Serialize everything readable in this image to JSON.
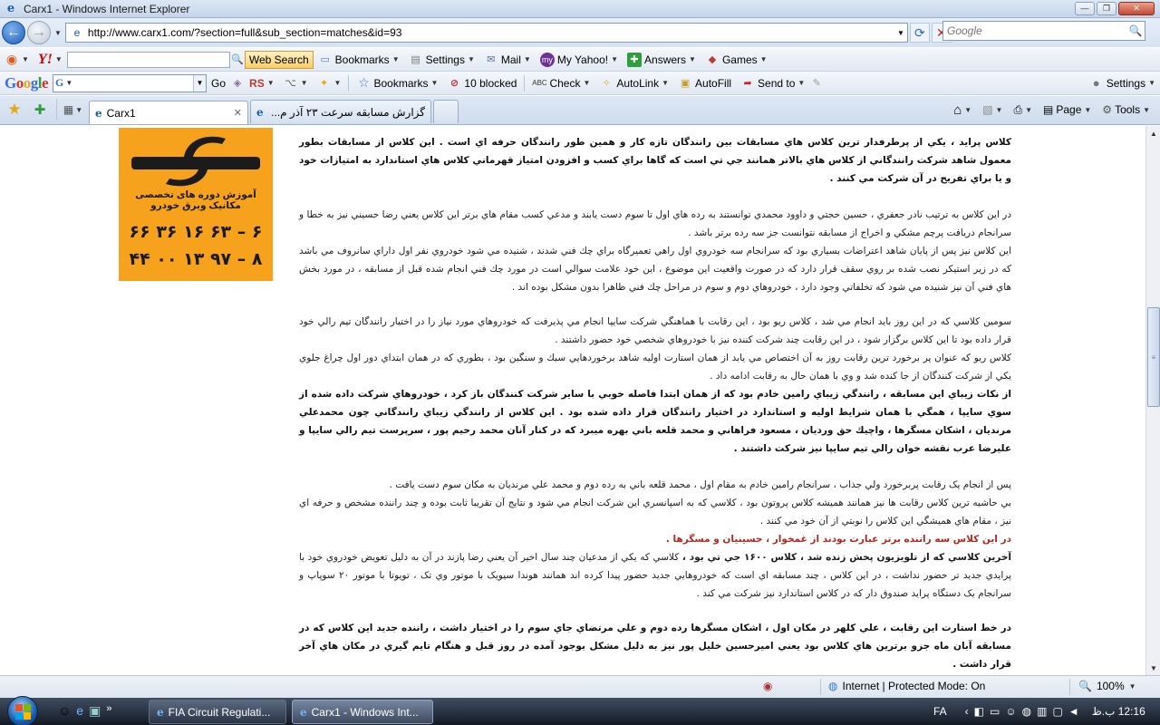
{
  "window": {
    "title": "Carx1 - Windows Internet Explorer",
    "minimize": "—",
    "maximize": "❐",
    "close": "✕"
  },
  "address": {
    "url": "http://www.carx1.com/?section=full&sub_section=matches&id=93",
    "search_placeholder": "Google"
  },
  "yahoo_toolbar": {
    "web_search": "Web Search",
    "bookmarks": "Bookmarks",
    "settings": "Settings",
    "mail": "Mail",
    "my_yahoo": "My Yahoo!",
    "answers": "Answers",
    "games": "Games"
  },
  "google_toolbar": {
    "go": "Go",
    "rs": "RS",
    "bookmarks": "Bookmarks",
    "blocked": "10 blocked",
    "check": "Check",
    "autolink": "AutoLink",
    "autofill": "AutoFill",
    "send_to": "Send to",
    "settings": "Settings"
  },
  "tabs": [
    {
      "label": "Carx1",
      "active": true
    },
    {
      "label": "گزارش مسابقه سرعت ۲۳ آذر م...",
      "active": false
    }
  ],
  "command_bar": {
    "page": "Page",
    "tools": "Tools"
  },
  "ad": {
    "text": "آموزش دوره های تخصصی مکانیک وبرق خودرو",
    "phone1": "۶۶ ۳۶ ۱۶ ۶۳ – ۶",
    "phone2": "۴۴ ۰۰ ۱۳ ۹۷ – ۸",
    "brand_color": "#f7a21c"
  },
  "article": {
    "p1": "كلاس پرايد ، يكي از پرطرفدار ترين كلاس هاي مسابقات بين رانندگان تازه كار و همين طور رانندگان حرفه اي است . اين كلاس از مسابقات بطور معمول شاهد شركت رانندگاني از كلاس هاي بالاتر همانند جي تي است كه گاها براي كسب و افزودن امتياز قهرماني كلاس هاي استاندارد به امتيازات خود و يا براي تفريح در آن شركت مي كنند .",
    "p2": "در اين كلاس به ترتيب نادر جعفري ، حسين حجتي و داوود محمدي توانستند به رده هاي اول تا سوم دست يابند و مدعي كسب مقام هاي برتر اين كلاس يعني رضا حسيني نيز به خطا و سرانجام دريافت پرچم مشكي و اخراج از مسابقه نتوانست جز سه رده برتر باشد .",
    "p3": "اين كلاس نيز پس از پايان شاهد اعتراضات بسياري بود كه سرانجام سه خودروي اول راهي تعميرگاه براي چك فني شدند ، شنيده مي شود خودروي نفر اول داراي سانروف مي باشد كه در زير استيكر نصب شده بر روي سقف قرار دارد كه در صورت واقعيت اين موضوع ، اين خود علامت سوالي است در مورد چك فني انجام شده قبل از مسابقه ، در مورد بخش هاي فني آن نيز شنيده مي شود كه تخلفاتي وجود دارد ، خودروهاي دوم و سوم در مراحل چك فني ظاهرا بدون مشكل بوده اند .",
    "p4": "سومين كلاسي كه در اين روز بايد انجام مي شد ، كلاس ريو بود ، اين رقابت با هماهنگي شركت سايپا انجام مي پذيرفت كه خودروهاي مورد نياز را در اختيار رانندگان تيم رالي خود قرار داده بود تا اين كلاس برگزار شود ، در اين رقابت چند شركت كننده نيز با خودروهاي شخصي خود حضور داشتند .",
    "p5": "كلاس ريو كه عنوان پر برخورد ترين رقابت روز به آن اختصاص مي يابد از همان استارت اوليه شاهد برخوردهايي سبك و سنگين بود ، بطوري كه در همان ابتداي دور اول چراغ جلوي يكي از شركت كنندگان از جا كنده شد و وي با همان حال به رقابت ادامه داد .",
    "p6": "از نكات زيباي اين مسابقه ، رانندگي زيباي رامين خادم بود كه از همان ابتدا فاصله خوبي با ساير شركت كنندگان باز كرد ، خودروهاي شركت داده شده از سوي سايپا ، همگي با همان شرايط اوليه و استاندارد در اختيار رانندگان قرار داده شده بود . اين كلاس از رانندگي زيباي رانندگاني چون محمدعلي مرنديان ، اشكان مسگرها ، واچيك حق ورديان ، مسعود فراهاني و محمد قلعه باني بهره ميبرد كه در كنار آنان محمد رحيم پور ، سرپرست تيم رالي سايپا و عليرضا عرب نقشه خوان رالي تيم سايپا نيز شركت داشتند .",
    "p7": "پس از انجام يک رقابت پربرخورد ولي جذاب ، سرانجام رامين خادم به مقام اول ، محمد قلعه باني به رده دوم و محمد علي مرنديان به مكان سوم دست يافت .",
    "p8": "بي حاشيه ترين كلاس رقابت ها نيز همانند هميشه كلاس پروتون بود ، كلاسي كه به اسپانسري اين شركت انجام مي شود و نتايج آن تقريبا ثابت بوده و چند راننده مشخص و حرفه اي نيز ، مقام هاي هميشگي اين كلاس را نوبتي از آن خود مي كنند .",
    "p9": "در اين كلاس سه راننده برتر عبارت بودند از غمخوار ، حسينيان و مسگرها .",
    "p10_lead": "آخرين كلاسي كه از تلويزيون پخش زنده شد ، كلاس ۱۶۰۰ جي تي بود ،",
    "p10": " كلاسي كه يكي از مدعيان چند سال اخير آن يعني رضا پازند در آن به دليل تعويض خودروي خود با پرايدي جديد تر حضور نداشت ، در اين كلاس ، چند مسابقه اي است كه خودروهايي جديد حضور پيدا كرده اند همانند هوندا سيويک با موتور وي تک ، تويوتا با موتور ۲۰ سوپاپ و سرانجام يک دستگاه پرايد صندوق دار كه در كلاس استاندارد نيز شركت مي كند .",
    "p11": "در خط استارت اين رقابت ، علي كلهر در مكان اول ، اشكان مسگرها رده دوم و علي مرتضاي جاي سوم را در اختيار داشت ، راننده جديد اين كلاس كه در مسابقه آبان ماه جزو برترين هاي كلاس بود يعني اميرحسين خليل پور نيز به دليل مشكل بوجود آمده در روز قبل و هنگام تايم گيري در مكان هاي آخر قرار داشت ."
  },
  "status": {
    "zone": "Internet | Protected Mode: On",
    "zoom": "100%"
  },
  "taskbar": {
    "task1": "FIA Circuit Regulati...",
    "task2": "Carx1 - Windows Int...",
    "lang": "FA",
    "time": "12:16 ب.ظ"
  }
}
